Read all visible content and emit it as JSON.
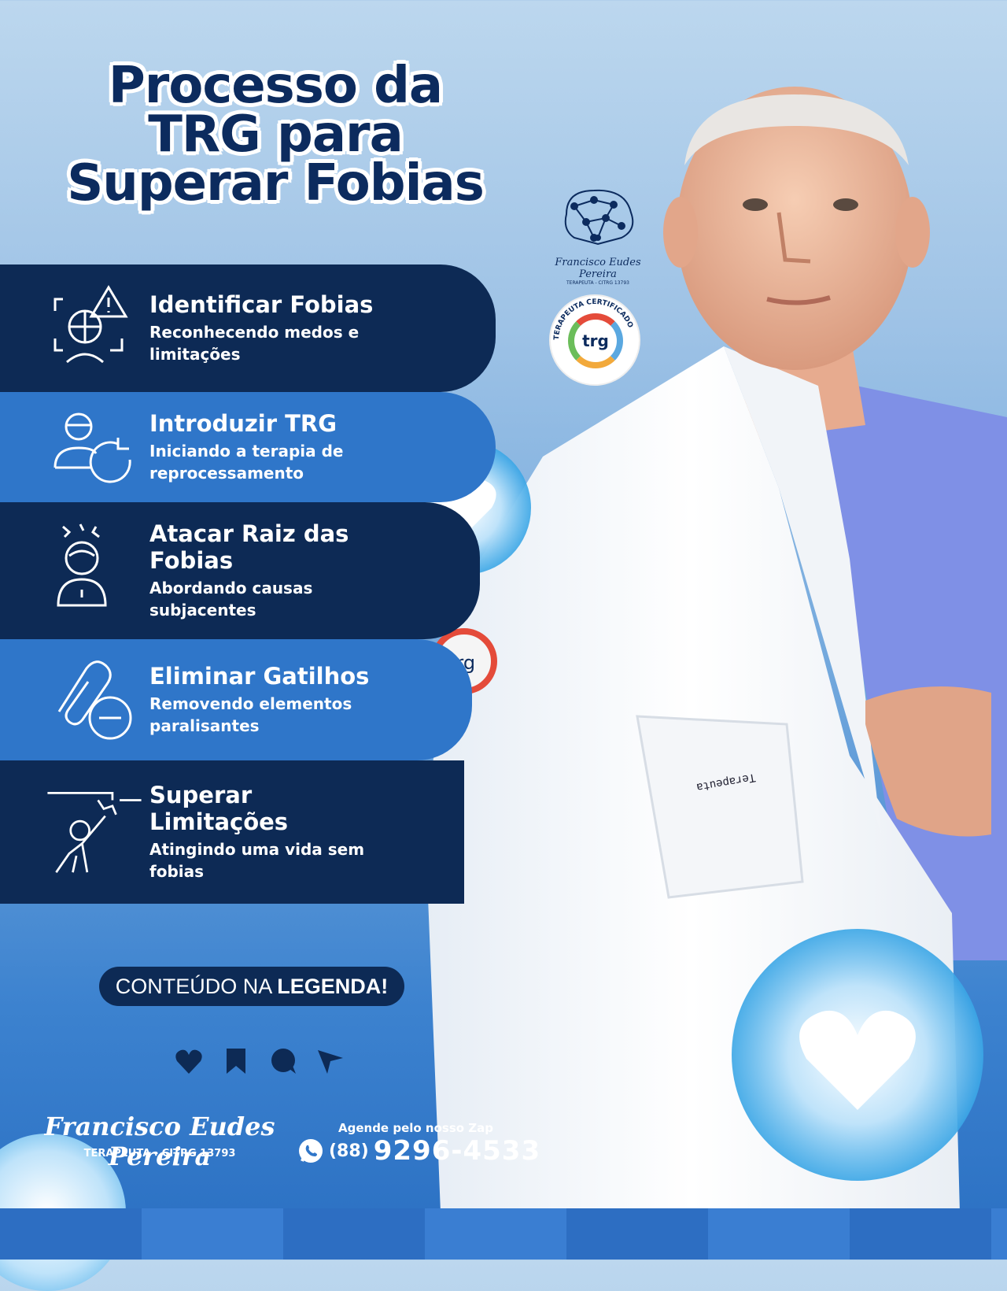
{
  "title": [
    "Processo da",
    "TRG para",
    "Superar Fobias"
  ],
  "steps": [
    {
      "title": "Identificar Fobias",
      "desc": [
        "Reconhecendo medos e",
        "limitações"
      ],
      "icon": "face-scan-warning-icon"
    },
    {
      "title": "Introduzir TRG",
      "desc": [
        "Iniciando a terapia de",
        "reprocessamento"
      ],
      "icon": "person-refresh-icon"
    },
    {
      "title": "Atacar Raiz das",
      "title2": "Fobias",
      "desc": [
        "Abordando causas",
        "subjacentes"
      ],
      "icon": "stressed-person-icon"
    },
    {
      "title": "Eliminar Gatilhos",
      "desc": [
        "Removendo elementos",
        "paralisantes"
      ],
      "icon": "paperclip-remove-icon"
    },
    {
      "title": "Superar",
      "title2": "Limitações",
      "desc": [
        "Atingindo uma vida sem",
        "fobias"
      ],
      "icon": "person-breaking-ceiling-icon"
    }
  ],
  "logo": {
    "signature": "Francisco Eudes Pereira",
    "subtitle": "TERAPEUTA - CITRG 13793",
    "icon": "brain-network-icon"
  },
  "seal": {
    "label": "trg",
    "ring_text": "TERAPEUTA CERTIFICADO"
  },
  "cta": {
    "normal": "CONTEÚDO NA ",
    "bold": "LEGENDA!"
  },
  "actions": [
    "heart-icon",
    "bookmark-icon",
    "comment-icon",
    "send-icon"
  ],
  "footer": {
    "signature": "Francisco Eudes Pereira",
    "subtitle": "TERAPEUTA - CITRG 13793",
    "zap_label": "Agende pelo nosso Zap",
    "ddd": "(88)",
    "phone": "9296-4533"
  },
  "colors": {
    "dark": "#0d2a55",
    "mid": "#2f76c9",
    "title": "#0c2b5e"
  }
}
